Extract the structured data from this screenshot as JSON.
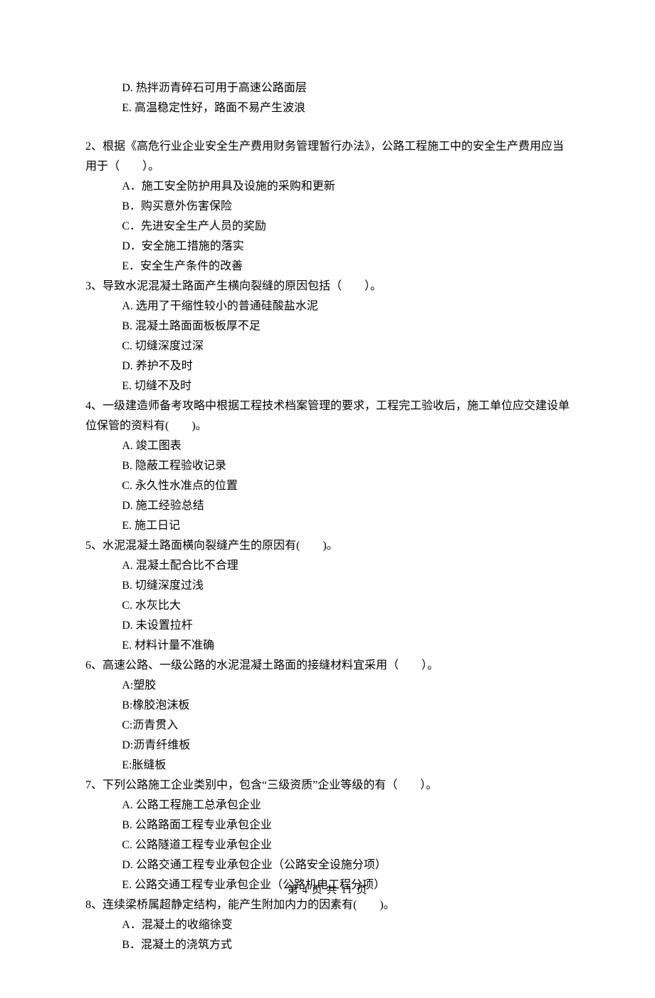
{
  "q1_tail": {
    "D": "D. 热拌沥青碎石可用于高速公路面层",
    "E": "E. 高温稳定性好，路面不易产生波浪"
  },
  "q2": {
    "stem": "2、根据《高危行业企业安全生产费用财务管理暂行办法》，公路工程施工中的安全生产费用应当用于（　　）。",
    "A": "A．施工安全防护用具及设施的采购和更新",
    "B": "B．购买意外伤害保险",
    "C": "C．先进安全生产人员的奖励",
    "D": "D．安全施工措施的落实",
    "E": "E．安全生产条件的改善"
  },
  "q3": {
    "stem": "3、导致水泥混凝土路面产生横向裂缝的原因包括（　　）。",
    "A": "A. 选用了干缩性较小的普通硅酸盐水泥",
    "B": "B. 混凝土路面面板板厚不足",
    "C": "C. 切缝深度过深",
    "D": "D. 养护不及时",
    "E": "E. 切缝不及时"
  },
  "q4": {
    "stem": "4、一级建造师备考攻略中根据工程技术档案管理的要求，工程完工验收后，施工单位应交建设单位保管的资料有(　　)。",
    "A": "A. 竣工图表",
    "B": "B. 隐蔽工程验收记录",
    "C": "C. 永久性水准点的位置",
    "D": "D. 施工经验总结",
    "E": "E. 施工日记"
  },
  "q5": {
    "stem": "5、水泥混凝土路面横向裂缝产生的原因有(　　)。",
    "A": "A. 混凝土配合比不合理",
    "B": "B. 切缝深度过浅",
    "C": "C. 水灰比大",
    "D": "D. 未设置拉杆",
    "E": "E. 材料计量不准确"
  },
  "q6": {
    "stem": "6、高速公路、一级公路的水泥混凝土路面的接缝材料宜采用（　　）。",
    "A": "A:塑胶",
    "B": "B:橡胶泡沫板",
    "C": "C:沥青贯入",
    "D": "D:沥青纤维板",
    "E": "E:胀缝板"
  },
  "q7": {
    "stem": "7、下列公路施工企业类别中，包含“三级资质”企业等级的有（　　）。",
    "A": "A. 公路工程施工总承包企业",
    "B": "B. 公路路面工程专业承包企业",
    "C": "C. 公路隧道工程专业承包企业",
    "D": "D. 公路交通工程专业承包企业（公路安全设施分项）",
    "E": "E. 公路交通工程专业承包企业（公路机电工程分项）"
  },
  "q8": {
    "stem": "8、连续梁桥属超静定结构，能产生附加内力的因素有(　　)。",
    "A": "A．混凝土的收缩徐变",
    "B": "B．混凝土的浇筑方式"
  },
  "footer": "第 4 页 共 11 页"
}
